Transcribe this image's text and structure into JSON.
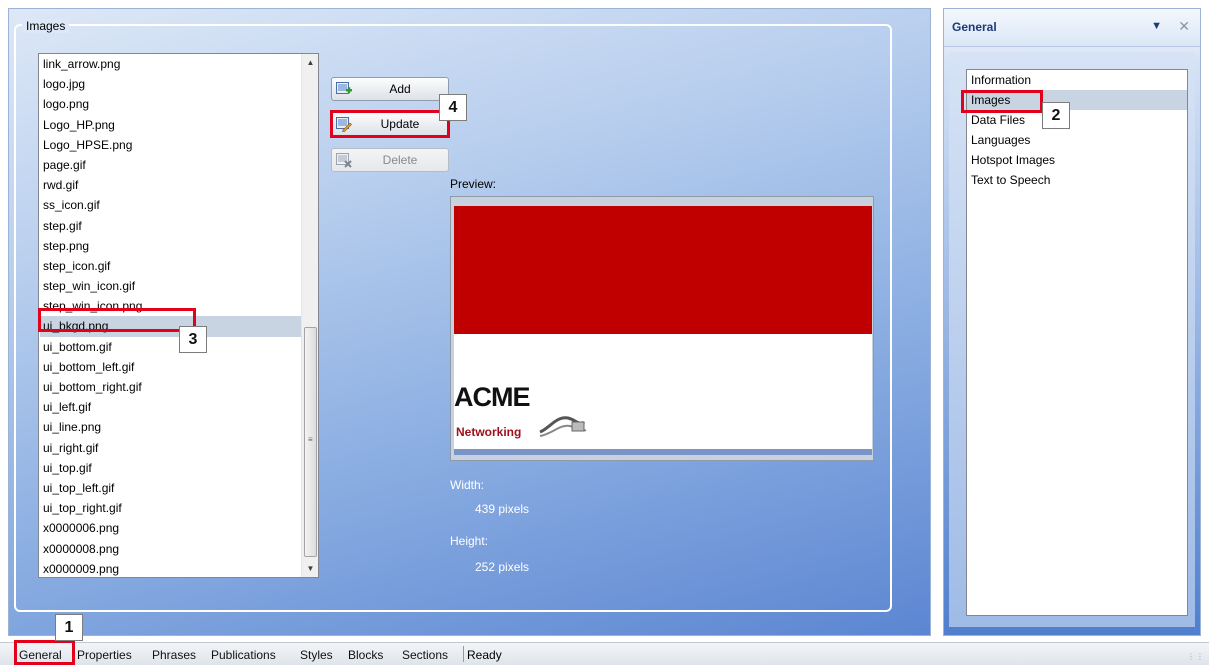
{
  "images_group": {
    "title": "Images"
  },
  "file_list": {
    "items": [
      "link_arrow.png",
      "logo.jpg",
      "logo.png",
      "Logo_HP.png",
      "Logo_HPSE.png",
      "page.gif",
      "rwd.gif",
      "ss_icon.gif",
      "step.gif",
      "step.png",
      "step_icon.gif",
      "step_win_icon.gif",
      "step_win_icon.png",
      "ui_bkgd.png",
      "ui_bottom.gif",
      "ui_bottom_left.gif",
      "ui_bottom_right.gif",
      "ui_left.gif",
      "ui_line.png",
      "ui_right.gif",
      "ui_top.gif",
      "ui_top_left.gif",
      "ui_top_right.gif",
      "x0000006.png",
      "x0000008.png",
      "x0000009.png"
    ],
    "selected": "ui_bkgd.png"
  },
  "buttons": {
    "add": "Add",
    "update": "Update",
    "delete": "Delete"
  },
  "preview": {
    "label": "Preview:",
    "logo_text": "ACME",
    "logo_subtext": "Networking",
    "width_label": "Width:",
    "width_value": "439 pixels",
    "height_label": "Height:",
    "height_value": "252 pixels"
  },
  "right_panel": {
    "title": "General",
    "items": [
      "Information",
      "Images",
      "Data Files",
      "Languages",
      "Hotspot Images",
      "Text to Speech"
    ],
    "selected": "Images"
  },
  "status_bar": {
    "tabs": [
      "General",
      "Properties",
      "Phrases",
      "Publications",
      "Styles",
      "Blocks",
      "Sections"
    ],
    "status": "Ready"
  },
  "callouts": [
    "1",
    "2",
    "3",
    "4"
  ],
  "colors": {
    "highlight": "#e2001a",
    "selection": "#c9d4e2",
    "preview_red": "#c00000"
  }
}
